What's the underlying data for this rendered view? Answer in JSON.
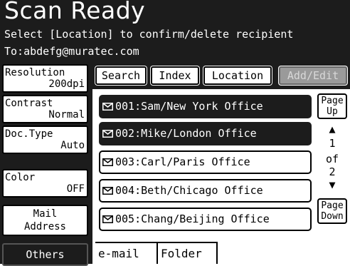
{
  "header": {
    "title": "Scan Ready",
    "instruction": "Select [Location] to confirm/delete recipient",
    "destination": "To:abdefg@muratec.com"
  },
  "left_panel": {
    "resolution": {
      "label": "Resolution",
      "value": "200dpi"
    },
    "contrast": {
      "label": "Contrast",
      "value": "Normal"
    },
    "doc_type": {
      "label": "Doc.Type",
      "value": "Auto"
    },
    "color": {
      "label": "Color",
      "value": "OFF"
    },
    "mail_address": {
      "line1": "Mail",
      "line2": "Address"
    },
    "others": "Others"
  },
  "tabs": {
    "search": "Search",
    "index": "Index",
    "location": "Location",
    "add_edit": "Add/Edit"
  },
  "entries": [
    {
      "label": "001:Sam/New York Office",
      "selected": true
    },
    {
      "label": "002:Mike/London Office",
      "selected": true
    },
    {
      "label": "003:Carl/Paris Office",
      "selected": false
    },
    {
      "label": "004:Beth/Chicago Office",
      "selected": false
    },
    {
      "label": "005:Chang/Beijing Office",
      "selected": false
    }
  ],
  "pager": {
    "up_line1": "Page",
    "up_line2": "Up",
    "down_line1": "Page",
    "down_line2": "Down",
    "current": "1",
    "of": "of",
    "total": "2",
    "up_arrow": "▲",
    "down_arrow": "▼"
  },
  "bottom_tabs": {
    "email": "e-mail",
    "folder": "Folder"
  },
  "icons": {
    "entry_icon": "envelope-icon"
  },
  "colors": {
    "dark": "#1c1c1c",
    "disabled": "#9a9a9a"
  }
}
